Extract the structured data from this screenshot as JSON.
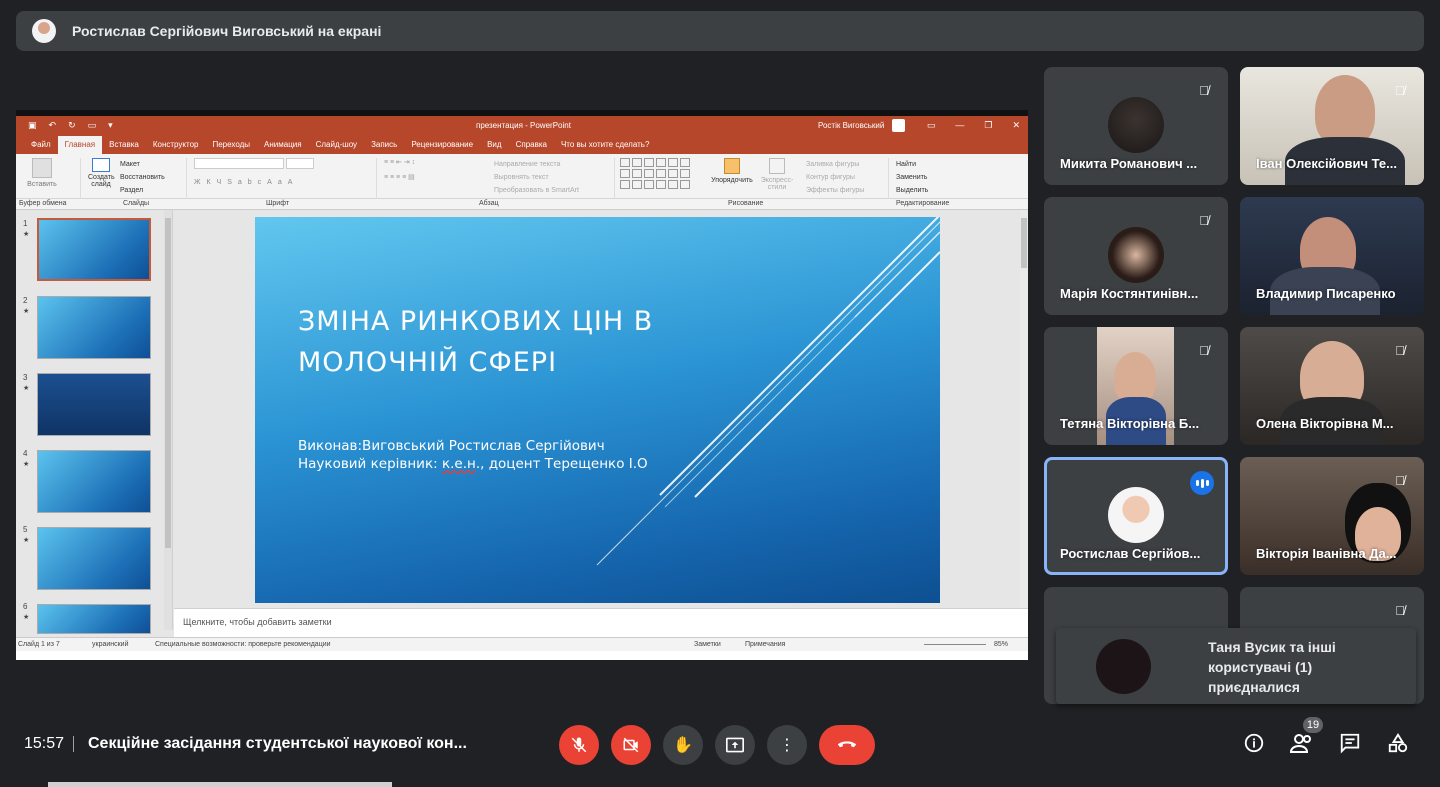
{
  "presenter_bar": {
    "text": "Ростислав Сергійович Виговський на екрані"
  },
  "ppt": {
    "window_title": "презентация - PowerPoint",
    "user": "Ростік Виговський",
    "tabs": [
      "Файл",
      "Главная",
      "Вставка",
      "Конструктор",
      "Переходы",
      "Анимация",
      "Слайд-шоу",
      "Запись",
      "Рецензирование",
      "Вид",
      "Справка",
      "Что вы хотите сделать?"
    ],
    "groups": [
      "Буфер обмена",
      "Слайды",
      "Шрифт",
      "Абзац",
      "Рисование",
      "Редактирование"
    ],
    "ribbon": {
      "paste": "Вставить",
      "new_slide": "Создать слайд",
      "layout": "Макет",
      "reset": "Восстановить",
      "section": "Раздел",
      "text_direction": "Направление текста",
      "align_text": "Выровнять текст",
      "smartart": "Преобразовать в SmartArt",
      "arrange": "Упорядочить",
      "quick_styles": "Экспресс-стили",
      "fill": "Заливка фигуры",
      "outline": "Контур фигуры",
      "effects": "Эффекты фигуры",
      "find": "Найти",
      "replace": "Заменить",
      "select": "Выделить"
    },
    "thumbnails": [
      "1",
      "2",
      "3",
      "4",
      "5",
      "6"
    ],
    "slide": {
      "title_line1": "ЗМІНА РИНКОВИХ ЦІН В",
      "title_line2": "МОЛОЧНІЙ СФЕРІ",
      "sub_line1": "Виконав:Виговський Ростислав Сергійович",
      "sub_line2a": "Науковий керівник: ",
      "sub_line2b": "к.е.н",
      "sub_line2c": "., доцент Терещенко І.О"
    },
    "notes_placeholder": "Щелкните, чтобы добавить заметки",
    "status": {
      "slide": "Слайд 1 из 7",
      "lang": "украинский",
      "access": "Специальные возможности: проверьте рекомендации",
      "notes": "Заметки",
      "comments": "Примечания",
      "zoom": "85%"
    }
  },
  "participants": [
    {
      "name": "Микита Романович ...",
      "muted": true
    },
    {
      "name": "Іван Олексійович Те...",
      "muted": true
    },
    {
      "name": "Марія Костянтинівн...",
      "muted": true
    },
    {
      "name": "Владимир Писаренко",
      "muted": false
    },
    {
      "name": "Тетяна Вікторівна Б...",
      "muted": true
    },
    {
      "name": "Олена Вікторівна М...",
      "muted": true
    },
    {
      "name": "Ростислав Сергійов...",
      "muted": false
    },
    {
      "name": "Вікторія Іванівна Да...",
      "muted": true
    }
  ],
  "toast": {
    "text": "Таня Вусик та інші користувачі (1) приєдналися"
  },
  "bottom": {
    "time": "15:57",
    "meeting": "Секційне засідання студентської наукової кон...",
    "people_count": "19"
  }
}
